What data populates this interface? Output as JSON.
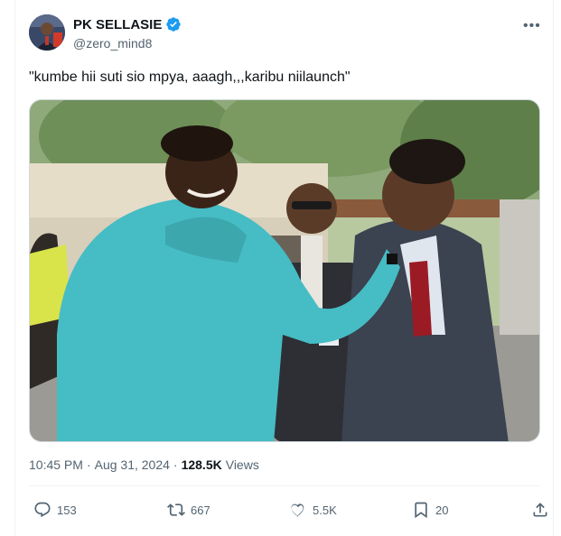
{
  "author": {
    "display_name": "PK SELLASIE",
    "handle": "@zero_mind8",
    "verified": true
  },
  "tweet": {
    "text": "\"kumbe hii suti sio mpya, aaagh,,,karibu niilaunch\"",
    "time": "10:45 PM",
    "separator": "·",
    "date": "Aug 31, 2024",
    "views_count": "128.5K",
    "views_label": "Views"
  },
  "actions": {
    "replies": "153",
    "reposts": "667",
    "likes": "5.5K",
    "bookmarks": "20"
  },
  "colors": {
    "verified": "#1d9bf0",
    "text_primary": "#0f1419",
    "text_secondary": "#536471",
    "border": "#eff3f4"
  },
  "icons": [
    "more-icon",
    "verified-badge-icon",
    "reply-icon",
    "repost-icon",
    "like-icon",
    "bookmark-icon",
    "share-icon"
  ]
}
